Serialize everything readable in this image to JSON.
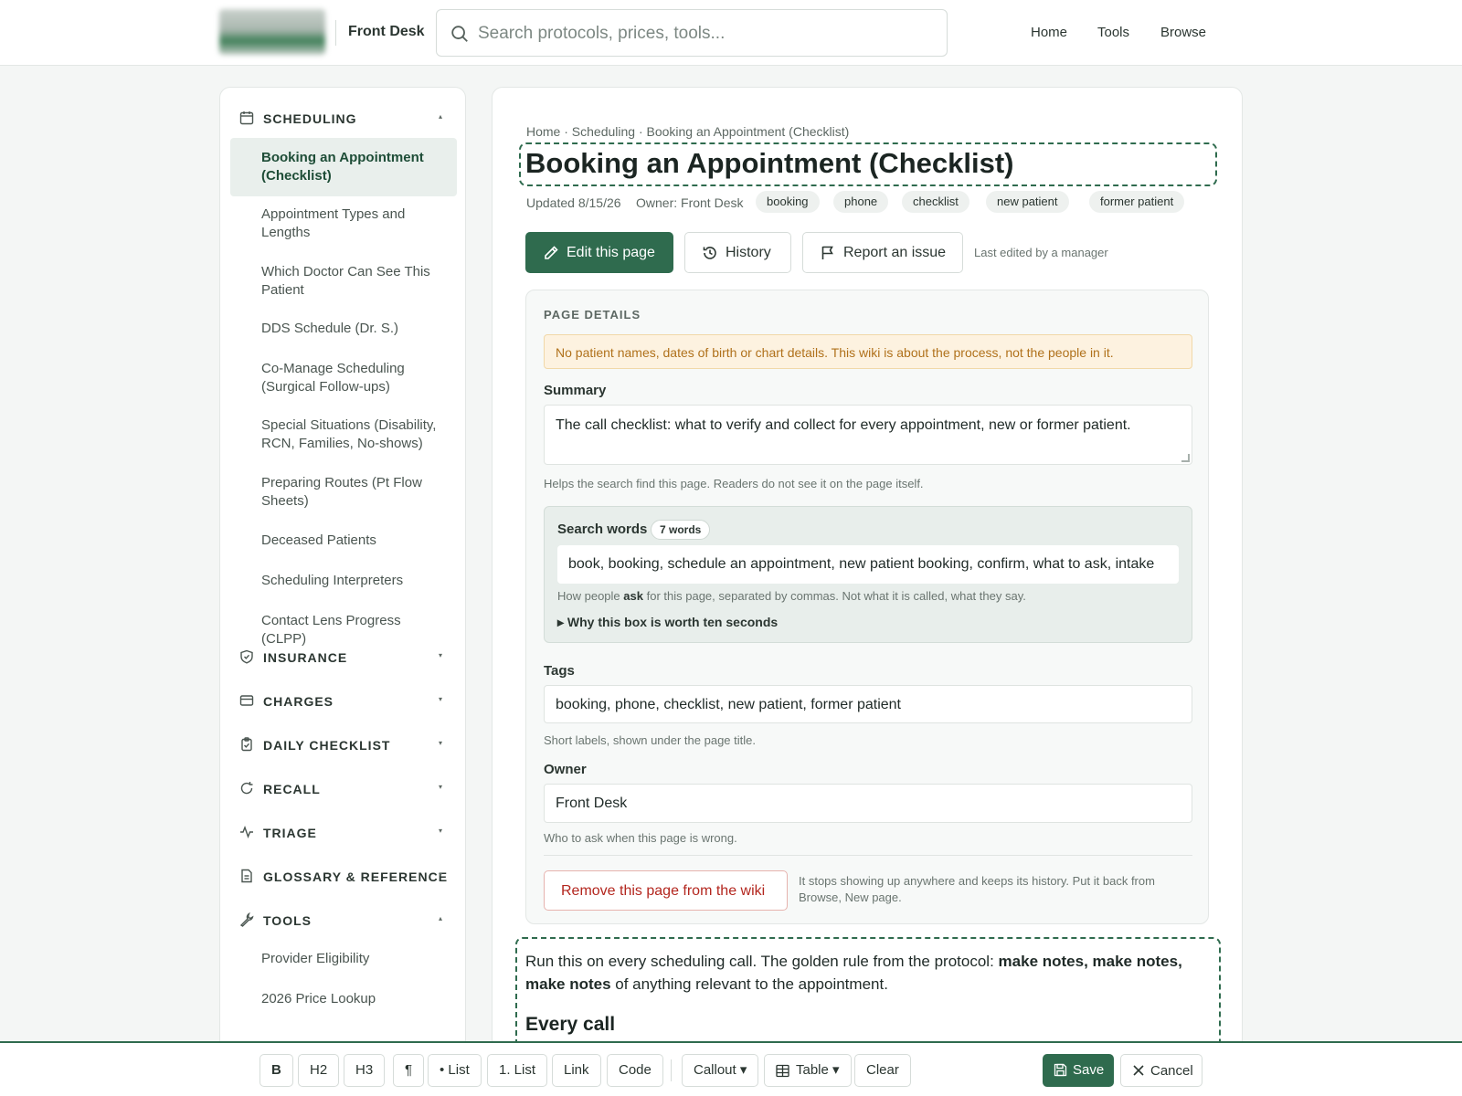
{
  "header": {
    "brand": "Front Desk",
    "search_placeholder": "Search protocols, prices, tools...",
    "nav": [
      "Home",
      "Tools",
      "Browse"
    ]
  },
  "sidebar": {
    "scheduling": {
      "title": "SCHEDULING",
      "items": [
        "Booking an Appointment (Checklist)",
        "Appointment Types and Lengths",
        "Which Doctor Can See This Patient",
        "DDS Schedule (Dr. S.)",
        "Co-Manage Scheduling (Surgical Follow-ups)",
        "Special Situations (Disability, RCN, Families, No-shows)",
        "Preparing Routes (Pt Flow Sheets)",
        "Deceased Patients",
        "Scheduling Interpreters",
        "Contact Lens Progress (CLPP)"
      ]
    },
    "sections": [
      "INSURANCE",
      "CHARGES",
      "DAILY CHECKLIST",
      "RECALL",
      "TRIAGE",
      "GLOSSARY & REFERENCE"
    ],
    "tools": {
      "title": "TOOLS",
      "items": [
        "Provider Eligibility",
        "2026 Price Lookup"
      ]
    }
  },
  "page": {
    "breadcrumb": "Home · Scheduling · Booking an Appointment (Checklist)",
    "title": "Booking an Appointment (Checklist)",
    "updated": "Updated 8/15/26",
    "owner_meta": "Owner: Front Desk",
    "tags": [
      "booking",
      "phone",
      "checklist",
      "new patient",
      "former patient"
    ],
    "actions": {
      "edit": "Edit this page",
      "history": "History",
      "report": "Report an issue",
      "last_edited": "Last edited by a manager"
    }
  },
  "details": {
    "label": "PAGE DETAILS",
    "warning": "No patient names, dates of birth or chart details. This wiki is about the process, not the people in it.",
    "summary_label": "Summary",
    "summary_value": "The call checklist: what to verify and collect for every appointment, new or former patient.",
    "summary_help": "Helps the search find this page. Readers do not see it on the page itself.",
    "search_words_label": "Search words",
    "search_words_badge": "7 words",
    "search_words_value": "book, booking, schedule an appointment, new patient booking, confirm, what to ask, intake",
    "search_words_help_pre": "How people",
    "search_words_help_bold": "ask",
    "search_words_help_post": "for this page, separated by commas. Not what it is called, what they say.",
    "why": "▸ Why this box is worth ten seconds",
    "tags_label": "Tags",
    "tags_value": "booking, phone, checklist, new patient, former patient",
    "tags_help": "Short labels, shown under the page title.",
    "owner_label": "Owner",
    "owner_value": "Front Desk",
    "owner_help": "Who to ask when this page is wrong.",
    "remove_button": "Remove this page from the wiki",
    "remove_help": "It stops showing up anywhere and keeps its history. Put it back from Browse, New page."
  },
  "body": {
    "intro_pre": "Run this on every scheduling call. The golden rule from the protocol:",
    "intro_bold": "make notes, make notes, make notes",
    "intro_post": "of anything relevant to the appointment.",
    "heading": "Every call"
  },
  "toolbar": {
    "buttons": [
      "B",
      "H2",
      "H3",
      "¶",
      "• List",
      "1. List",
      "Link",
      "Code",
      "Callout ▾",
      "Table ▾",
      "Clear"
    ],
    "save": "Save",
    "cancel": "Cancel"
  },
  "colors": {
    "accent": "#2f6b4e",
    "warning_bg": "#fdf2e0",
    "warning_text": "#b0711b",
    "danger": "#b3261e"
  }
}
